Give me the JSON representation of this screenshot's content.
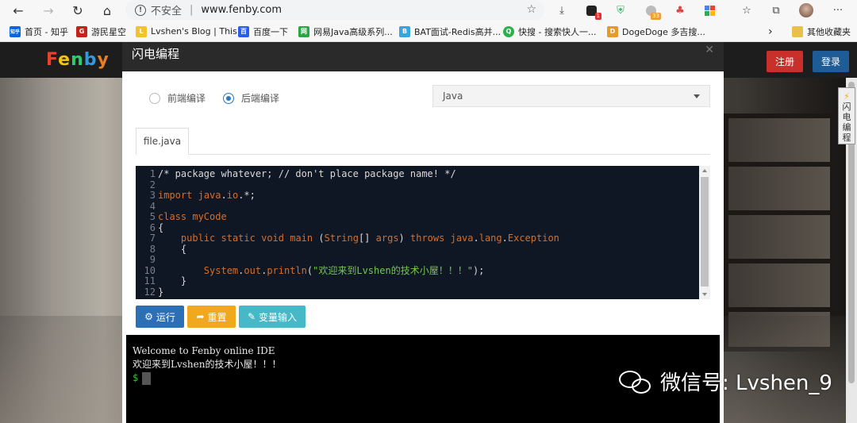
{
  "browser": {
    "insecure_label": "不安全",
    "separator": "|",
    "url": "www.fenby.com",
    "ext_badges": {
      "mail": "1",
      "chat": "33"
    }
  },
  "bookmarks": {
    "items": [
      {
        "label": "首页 - 知乎",
        "icon": "zhihu-icon",
        "color": "#0b66e4",
        "glyph": "知乎"
      },
      {
        "label": "游民星空",
        "icon": "gamersky-icon",
        "color": "#c0241b",
        "glyph": "G"
      },
      {
        "label": "Lvshen's Blog | This...",
        "icon": "blog-icon",
        "color": "#f2c230",
        "glyph": "L"
      },
      {
        "label": "百度一下",
        "icon": "baidu-icon",
        "color": "#2a5ee8",
        "glyph": "百"
      },
      {
        "label": "网易Java高级系列...",
        "icon": "netease-icon",
        "color": "#2ea544",
        "glyph": "网"
      },
      {
        "label": "BAT面试-Redis高并...",
        "icon": "bat-icon",
        "color": "#35a6e0",
        "glyph": "B"
      },
      {
        "label": "快搜 - 搜索快人一...",
        "icon": "kuaisou-icon",
        "color": "#2bb24c",
        "glyph": "Q"
      },
      {
        "label": "DogeDoge 多吉搜...",
        "icon": "doge-icon",
        "color": "#e79a2a",
        "glyph": "D"
      }
    ],
    "other_folder": "其他收藏夹"
  },
  "site": {
    "logo": [
      "F",
      "e",
      "n",
      "b",
      "y"
    ],
    "register": "注册",
    "login": "登录",
    "side_tab": [
      "闪",
      "电",
      "编",
      "程"
    ]
  },
  "modal": {
    "title": "闪电编程",
    "radio_front": "前端编译",
    "radio_back": "后端编译",
    "selected_mode": "后端编译",
    "language": "Java",
    "tab": "file.java",
    "buttons": {
      "run": "运行",
      "reset": "重置",
      "var_input": "变量输入"
    },
    "code_lines": [
      "/* package whatever; // don't place package name! */",
      "",
      "import java.io.*;",
      "",
      "class myCode",
      "{",
      "    public static void main (String[] args) throws java.lang.Exception",
      "    {",
      "",
      "        System.out.println(\"欢迎来到Lvshen的技术小屋！！！\");",
      "    }",
      "}"
    ],
    "line_numbers": [
      "1",
      "2",
      "3",
      "4",
      "5",
      "6",
      "7",
      "8",
      "9",
      "10",
      "11",
      "12"
    ]
  },
  "terminal": {
    "lines": [
      "Welcome to Fenby online IDE",
      "欢迎来到Lvshen的技术小屋！！！"
    ],
    "prompt": "$"
  },
  "watermark": "微信号: Lvshen_9"
}
